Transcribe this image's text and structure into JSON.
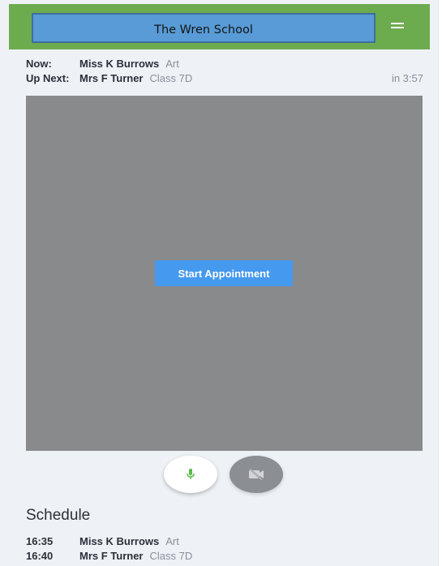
{
  "header": {
    "school_name": "The Wren School",
    "menu_icon": "hamburger-menu-icon",
    "bar_color": "#6dab4f",
    "brand_color": "#589bd6"
  },
  "status": {
    "now": {
      "label": "Now:",
      "name": "Miss K Burrows",
      "subject": "Art"
    },
    "next": {
      "label": "Up Next:",
      "name": "Mrs F Turner",
      "subject": "Class 7D",
      "countdown": "in 3:57"
    }
  },
  "video": {
    "start_button_label": "Start Appointment",
    "button_color": "#4599ee"
  },
  "controls": {
    "mic_icon": "microphone-icon",
    "camera_icon": "camera-off-icon",
    "mic_color": "#58b848"
  },
  "schedule": {
    "title": "Schedule",
    "items": [
      {
        "time": "16:35",
        "name": "Miss K Burrows",
        "subject": "Art"
      },
      {
        "time": "16:40",
        "name": "Mrs F Turner",
        "subject": "Class 7D"
      }
    ]
  }
}
